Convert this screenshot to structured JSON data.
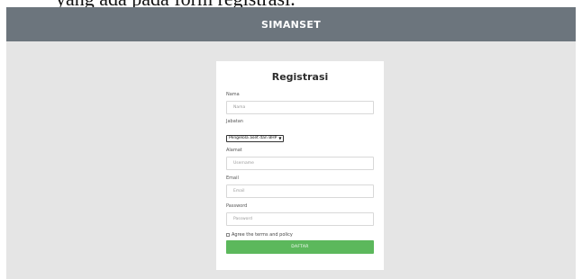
{
  "caption": "yang ada pada form registrasi.",
  "header": {
    "brand": "SIMANSET"
  },
  "form": {
    "title": "Registrasi",
    "nama": {
      "label": "Nama",
      "placeholder": "Nama"
    },
    "jabatan": {
      "label": "Jabatan",
      "selected": "Pengelola aset dan BHP"
    },
    "alamat": {
      "label": "Alamat",
      "placeholder": "Username"
    },
    "email": {
      "label": "Email",
      "placeholder": "Email"
    },
    "password": {
      "label": "Password",
      "placeholder": "Password"
    },
    "agree_label": "Agree the terms and policy",
    "submit_label": "DAFTAR"
  },
  "colors": {
    "header": "#6c757d",
    "background": "#e5e5e5",
    "button": "#5cb85c"
  }
}
